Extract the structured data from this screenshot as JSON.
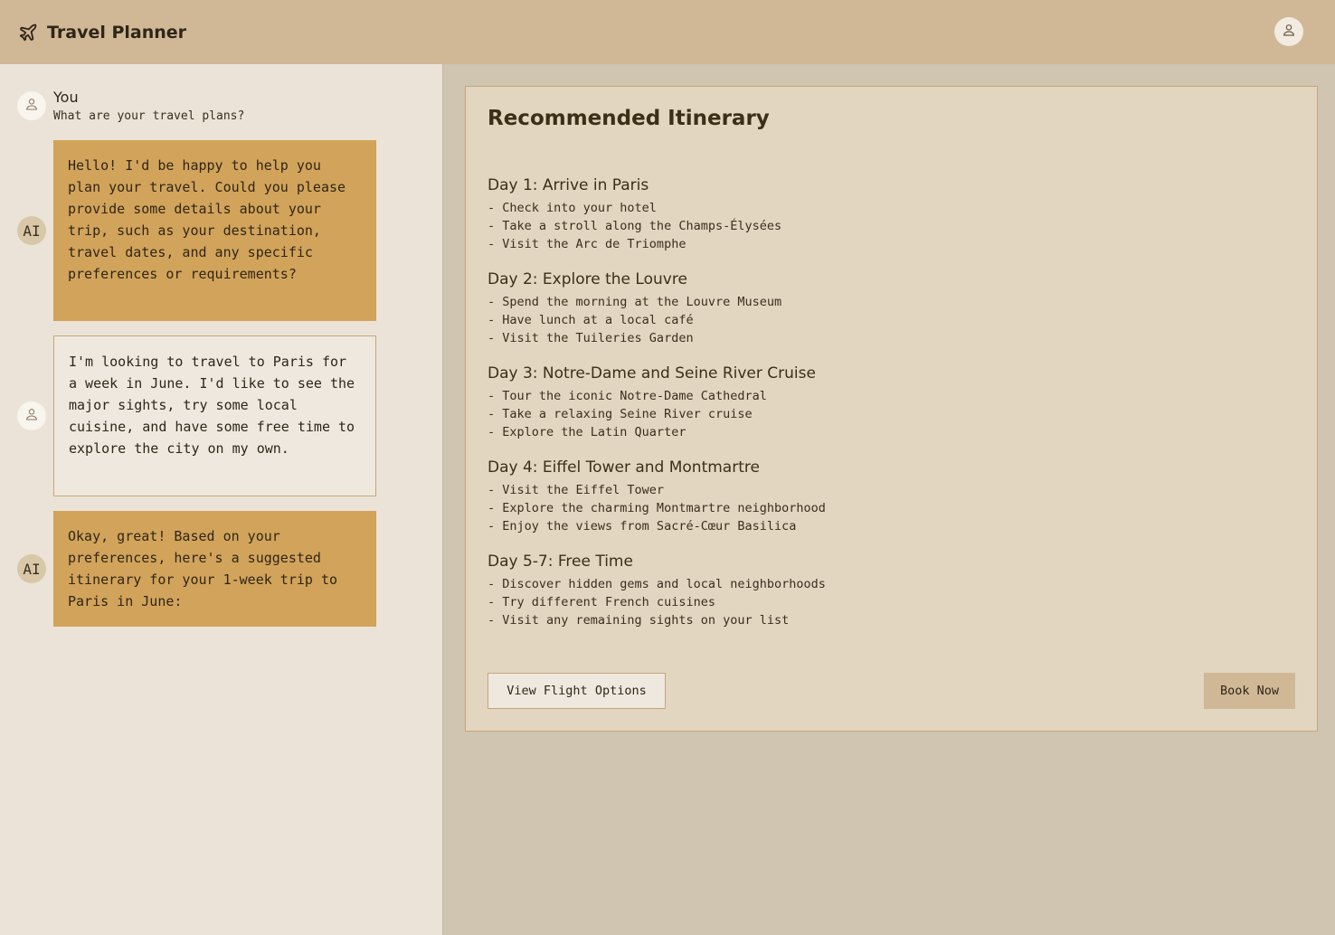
{
  "header": {
    "title": "Travel Planner",
    "logo_icon": "airplane-icon",
    "profile_icon": "user-icon"
  },
  "chat": {
    "you_name": "You",
    "you_prompt": "What are your travel plans?",
    "ai_avatar_label": "AI",
    "messages": [
      {
        "role": "ai",
        "text": "Hello! I'd be happy to help you plan your travel. Could you please provide some details about your trip, such as your destination, travel dates, and any specific preferences or requirements?"
      },
      {
        "role": "user",
        "text": "I'm looking to travel to Paris for a week in June. I'd like to see the major sights, try some local cuisine, and have some free time to explore the city on my own."
      },
      {
        "role": "ai",
        "text": "Okay, great! Based on your preferences, here's a suggested itinerary for your 1-week trip to Paris in June:"
      }
    ]
  },
  "itinerary": {
    "title": "Recommended Itinerary",
    "days": [
      {
        "title": "Day 1: Arrive in Paris",
        "items": [
          "- Check into your hotel",
          "- Take a stroll along the Champs-Élysées",
          "- Visit the Arc de Triomphe"
        ]
      },
      {
        "title": "Day 2: Explore the Louvre",
        "items": [
          "- Spend the morning at the Louvre Museum",
          "- Have lunch at a local café",
          "- Visit the Tuileries Garden"
        ]
      },
      {
        "title": "Day 3: Notre-Dame and Seine River Cruise",
        "items": [
          "- Tour the iconic Notre-Dame Cathedral",
          "- Take a relaxing Seine River cruise",
          "- Explore the Latin Quarter"
        ]
      },
      {
        "title": "Day 4: Eiffel Tower and Montmartre",
        "items": [
          "- Visit the Eiffel Tower",
          "- Explore the charming Montmartre neighborhood",
          "- Enjoy the views from Sacré-Cœur Basilica"
        ]
      },
      {
        "title": "Day 5-7: Free Time",
        "items": [
          "- Discover hidden gems and local neighborhoods",
          "- Try different French cuisines",
          "- Visit any remaining sights on your list"
        ]
      }
    ],
    "flight_button": "View Flight Options",
    "book_button": "Book Now"
  },
  "colors": {
    "header_bg": "#d0b896",
    "sidebar_bg": "#ebe3d7",
    "ai_bubble": "#d2a35a",
    "card_bg": "#e2d6c1"
  }
}
